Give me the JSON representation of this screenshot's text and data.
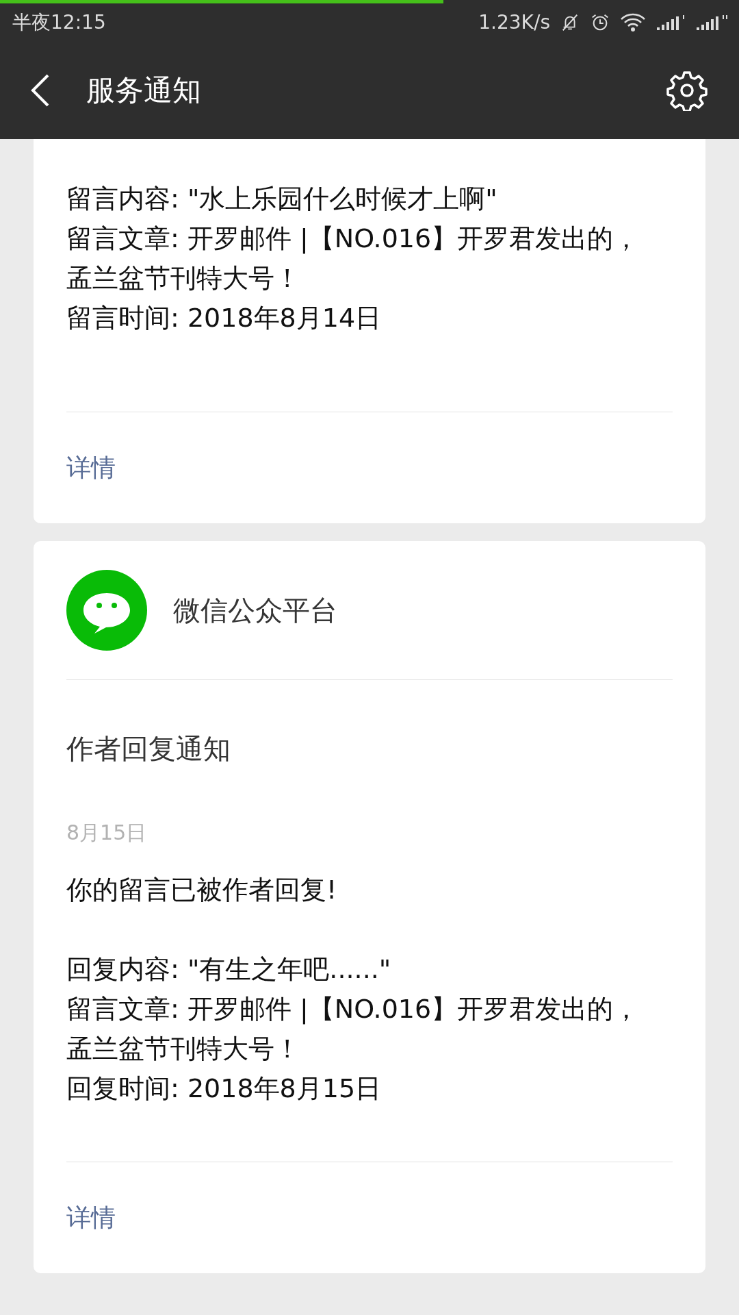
{
  "status_bar": {
    "time": "半夜12:15",
    "net_speed": "1.23K/s"
  },
  "progress": {
    "level": 0.6
  },
  "header": {
    "title": "服务通知"
  },
  "cards": [
    {
      "paragraphs": [
        [
          "留言内容: \"水上乐园什么时候才上啊\"",
          "留言文章: 开罗邮件 |【NO.016】开罗君发出的，孟兰盆节刊特大号！",
          "留言时间: 2018年8月14日"
        ]
      ],
      "link": "详情"
    },
    {
      "account": "微信公众平台",
      "title": "作者回复通知",
      "date": "8月15日",
      "paragraphs": [
        [
          "你的留言已被作者回复!"
        ],
        [
          "回复内容: \"有生之年吧......\"",
          "留言文章: 开罗邮件 |【NO.016】开罗君发出的，孟兰盆节刊特大号！",
          "回复时间: 2018年8月15日"
        ]
      ],
      "link": "详情"
    }
  ]
}
